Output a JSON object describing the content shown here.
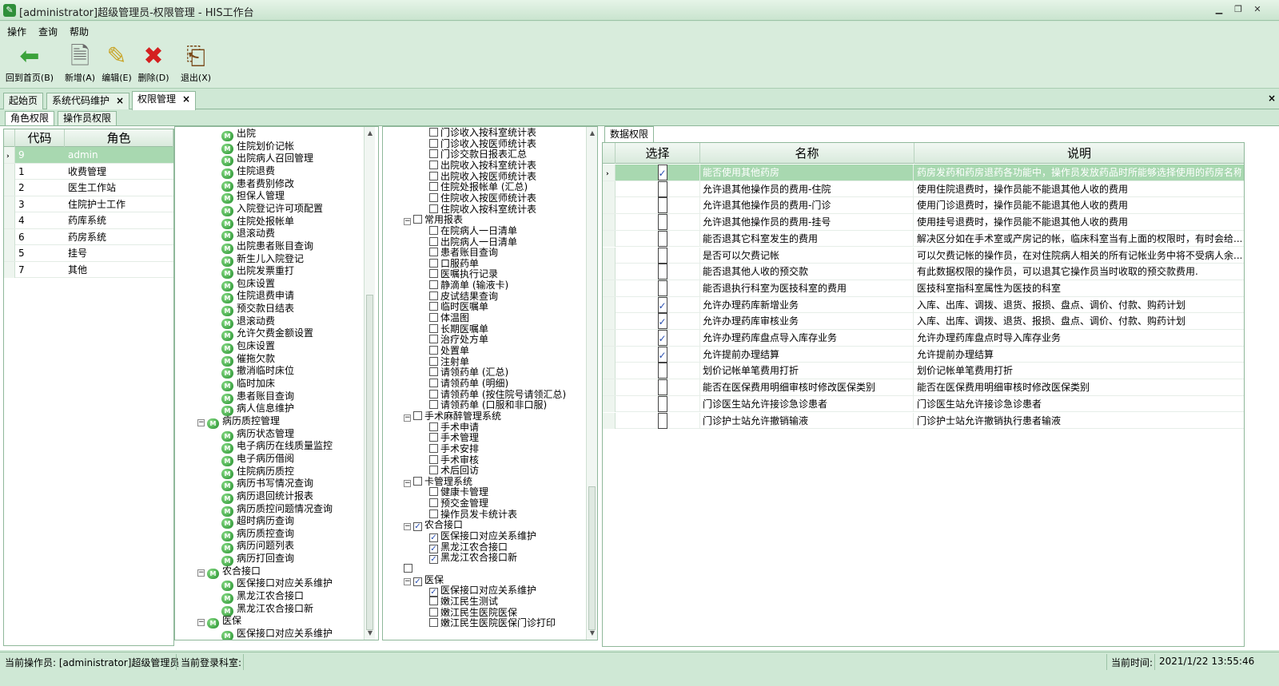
{
  "window": {
    "title": "[administrator]超级管理员-权限管理 - HIS工作台"
  },
  "menu": [
    "操作",
    "查询",
    "帮助"
  ],
  "toolbar": [
    {
      "label": "回到首页(B)",
      "icon": "home-arrow-icon"
    },
    {
      "label": "新增(A)",
      "icon": "new-doc-icon"
    },
    {
      "label": "编辑(E)",
      "icon": "edit-icon"
    },
    {
      "label": "删除(D)",
      "icon": "delete-icon"
    },
    {
      "label": "退出(X)",
      "icon": "exit-icon"
    }
  ],
  "doc_tabs": [
    {
      "label": "起始页"
    },
    {
      "label": "系统代码维护",
      "close": "×"
    },
    {
      "label": "权限管理",
      "close": "×"
    }
  ],
  "close_all": "×",
  "sub_tabs": [
    "角色权限",
    "操作员权限"
  ],
  "role_grid": {
    "headers": [
      "代码",
      "角色"
    ],
    "rows": [
      {
        "code": "9",
        "role": "admin"
      },
      {
        "code": "1",
        "role": "收费管理"
      },
      {
        "code": "2",
        "role": "医生工作站"
      },
      {
        "code": "3",
        "role": "住院护士工作"
      },
      {
        "code": "4",
        "role": "药库系统"
      },
      {
        "code": "6",
        "role": "药房系统"
      },
      {
        "code": "5",
        "role": "挂号"
      },
      {
        "code": "7",
        "role": "其他"
      }
    ]
  },
  "tree1": [
    {
      "label": "出院",
      "level": 2
    },
    {
      "label": "住院划价记帐",
      "level": 2
    },
    {
      "label": "出院病人召回管理",
      "level": 2
    },
    {
      "label": "住院退费",
      "level": 2
    },
    {
      "label": "患者费别修改",
      "level": 2
    },
    {
      "label": "担保人管理",
      "level": 2
    },
    {
      "label": "入院登记许可项配置",
      "level": 2
    },
    {
      "label": "住院处报帐单",
      "level": 2
    },
    {
      "label": "退滚动费",
      "level": 2
    },
    {
      "label": "出院患者账目查询",
      "level": 2
    },
    {
      "label": "新生儿入院登记",
      "level": 2
    },
    {
      "label": "出院发票重打",
      "level": 2
    },
    {
      "label": "包床设置",
      "level": 2
    },
    {
      "label": "住院退费申请",
      "level": 2
    },
    {
      "label": "预交款日结表",
      "level": 2
    },
    {
      "label": "退滚动费",
      "level": 2
    },
    {
      "label": "允许欠费金额设置",
      "level": 2
    },
    {
      "label": "包床设置",
      "level": 2
    },
    {
      "label": "催拖欠款",
      "level": 2
    },
    {
      "label": "撤消临时床位",
      "level": 2
    },
    {
      "label": "临时加床",
      "level": 2
    },
    {
      "label": "患者账目查询",
      "level": 2
    },
    {
      "label": "病人信息维护",
      "level": 2
    },
    {
      "label": "病历质控管理",
      "level": 1
    },
    {
      "label": "病历状态管理",
      "level": 2
    },
    {
      "label": "电子病历在线质量监控",
      "level": 2
    },
    {
      "label": "电子病历借阅",
      "level": 2
    },
    {
      "label": "住院病历质控",
      "level": 2
    },
    {
      "label": "病历书写情况查询",
      "level": 2
    },
    {
      "label": "病历退回统计报表",
      "level": 2
    },
    {
      "label": "病历质控问题情况查询",
      "level": 2
    },
    {
      "label": "超时病历查询",
      "level": 2
    },
    {
      "label": "病历质控查询",
      "level": 2
    },
    {
      "label": "病历问题列表",
      "level": 2
    },
    {
      "label": "病历打回查询",
      "level": 2
    },
    {
      "label": "农合接口",
      "level": 1
    },
    {
      "label": "医保接口对应关系维护",
      "level": 2
    },
    {
      "label": "黑龙江农合接口",
      "level": 2
    },
    {
      "label": "黑龙江农合接口新",
      "level": 2
    },
    {
      "label": "医保",
      "level": 1
    },
    {
      "label": "医保接口对应关系维护",
      "level": 2
    }
  ],
  "tree2": [
    {
      "label": "门诊收入按科室统计表",
      "level": 2,
      "checked": false
    },
    {
      "label": "门诊收入按医师统计表",
      "level": 2,
      "checked": false
    },
    {
      "label": "门诊交款日报表汇总",
      "level": 2,
      "checked": false
    },
    {
      "label": "出院收入按科室统计表",
      "level": 2,
      "checked": false
    },
    {
      "label": "出院收入按医师统计表",
      "level": 2,
      "checked": false
    },
    {
      "label": "住院处报帐单 (汇总)",
      "level": 2,
      "checked": false
    },
    {
      "label": "住院收入按医师统计表",
      "level": 2,
      "checked": false
    },
    {
      "label": "住院收入按科室统计表",
      "level": 2,
      "checked": false
    },
    {
      "label": "常用报表",
      "level": 1,
      "checked": false
    },
    {
      "label": "在院病人一日清单",
      "level": 2,
      "checked": false
    },
    {
      "label": "出院病人一日清单",
      "level": 2,
      "checked": false
    },
    {
      "label": "患者账目查询",
      "level": 2,
      "checked": false
    },
    {
      "label": "口服药单",
      "level": 2,
      "checked": false
    },
    {
      "label": "医嘱执行记录",
      "level": 2,
      "checked": false
    },
    {
      "label": "静滴单 (输液卡)",
      "level": 2,
      "checked": false
    },
    {
      "label": "皮试结果查询",
      "level": 2,
      "checked": false
    },
    {
      "label": "临时医嘱单",
      "level": 2,
      "checked": false
    },
    {
      "label": "体温图",
      "level": 2,
      "checked": false
    },
    {
      "label": "长期医嘱单",
      "level": 2,
      "checked": false
    },
    {
      "label": "治疗处方单",
      "level": 2,
      "checked": false
    },
    {
      "label": "处置单",
      "level": 2,
      "checked": false
    },
    {
      "label": "注射单",
      "level": 2,
      "checked": false
    },
    {
      "label": "请领药单 (汇总)",
      "level": 2,
      "checked": false
    },
    {
      "label": "请领药单 (明细)",
      "level": 2,
      "checked": false
    },
    {
      "label": "请领药单 (按住院号请领汇总)",
      "level": 2,
      "checked": false
    },
    {
      "label": "请领药单 (口服和非口服)",
      "level": 2,
      "checked": false
    },
    {
      "label": "手术麻醉管理系统",
      "level": 1,
      "checked": false
    },
    {
      "label": "手术申请",
      "level": 2,
      "checked": false
    },
    {
      "label": "手术管理",
      "level": 2,
      "checked": false
    },
    {
      "label": "手术安排",
      "level": 2,
      "checked": false
    },
    {
      "label": "手术审核",
      "level": 2,
      "checked": false
    },
    {
      "label": "术后回访",
      "level": 2,
      "checked": false
    },
    {
      "label": "卡管理系统",
      "level": 1,
      "checked": false
    },
    {
      "label": "健康卡管理",
      "level": 2,
      "checked": false
    },
    {
      "label": "预交金管理",
      "level": 2,
      "checked": false
    },
    {
      "label": "操作员发卡统计表",
      "level": 2,
      "checked": false
    },
    {
      "label": "农合接口",
      "level": 1,
      "checked": true
    },
    {
      "label": "医保接口对应关系维护",
      "level": 2,
      "checked": true
    },
    {
      "label": "黑龙江农合接口",
      "level": 2,
      "checked": true
    },
    {
      "label": "黑龙江农合接口新",
      "level": 2,
      "checked": true
    },
    {
      "label": "",
      "level": 1,
      "checked": false
    },
    {
      "label": "医保",
      "level": 1,
      "checked": true
    },
    {
      "label": "医保接口对应关系维护",
      "level": 2,
      "checked": true
    },
    {
      "label": "嫩江民生测试",
      "level": 2,
      "checked": false
    },
    {
      "label": "嫩江民生医院医保",
      "level": 2,
      "checked": false
    },
    {
      "label": "嫩江民生医院医保门诊打印",
      "level": 2,
      "checked": false
    }
  ],
  "perm_tab": "数据权限",
  "perm_grid": {
    "headers": [
      "选择",
      "名称",
      "说明"
    ],
    "rows": [
      {
        "checked": true,
        "name": "能否使用其他药房",
        "desc": "药房发药和药房退药各功能中，操作员发放药品时所能够选择使用的药房名称"
      },
      {
        "checked": false,
        "name": "允许退其他操作员的费用-住院",
        "desc": "使用住院退费时，操作员能不能退其他人收的费用"
      },
      {
        "checked": false,
        "name": "允许退其他操作员的费用-门诊",
        "desc": "使用门诊退费时，操作员能不能退其他人收的费用"
      },
      {
        "checked": false,
        "name": "允许退其他操作员的费用-挂号",
        "desc": "使用挂号退费时，操作员能不能退其他人收的费用"
      },
      {
        "checked": false,
        "name": "能否退其它科室发生的费用",
        "desc": "解决区分如在手术室或产房记的帐，临床科室当有上面的权限时，有时会给..."
      },
      {
        "checked": false,
        "name": "是否可以欠费记帐",
        "desc": "可以欠费记帐的操作员，在对住院病人相关的所有记帐业务中将不受病人余..."
      },
      {
        "checked": false,
        "name": "能否退其他人收的预交款",
        "desc": "有此数据权限的操作员，可以退其它操作员当时收取的预交款费用."
      },
      {
        "checked": false,
        "name": "能否退执行科室为医技科室的费用",
        "desc": "医技科室指科室属性为医技的科室"
      },
      {
        "checked": true,
        "name": "允许办理药库新增业务",
        "desc": "入库、出库、调拨、退货、报损、盘点、调价、付款、购药计划"
      },
      {
        "checked": true,
        "name": "允许办理药库审核业务",
        "desc": "入库、出库、调拨、退货、报损、盘点、调价、付款、购药计划"
      },
      {
        "checked": true,
        "name": "允许办理药库盘点导入库存业务",
        "desc": "允许办理药库盘点时导入库存业务"
      },
      {
        "checked": true,
        "name": "允许提前办理结算",
        "desc": "允许提前办理结算"
      },
      {
        "checked": false,
        "name": "划价记帐单笔费用打折",
        "desc": "划价记帐单笔费用打折"
      },
      {
        "checked": false,
        "name": "能否在医保费用明细审核时修改医保类别",
        "desc": "能否在医保费用明细审核时修改医保类别"
      },
      {
        "checked": false,
        "name": "门诊医生站允许接诊急诊患者",
        "desc": "门诊医生站允许接诊急诊患者"
      },
      {
        "checked": false,
        "name": "门诊护士站允许撤销输液",
        "desc": "门诊护士站允许撤销执行患者输液"
      }
    ]
  },
  "status": {
    "operator": "当前操作员: [administrator]超级管理员",
    "dept": "当前登录科室:",
    "time_label": "当前时间:",
    "time": "2021/1/22 13:55:46"
  }
}
